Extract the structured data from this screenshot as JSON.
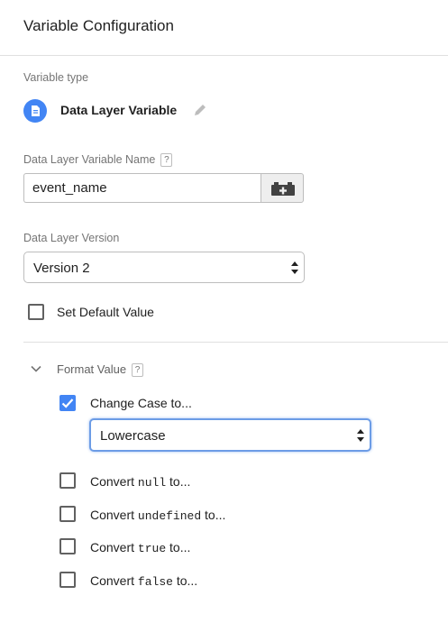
{
  "header": {
    "title": "Variable Configuration"
  },
  "variable_type": {
    "label": "Variable type",
    "name": "Data Layer Variable",
    "icon": "document-icon",
    "icon_color": "#4285f4"
  },
  "variable_name": {
    "label": "Data Layer Variable Name",
    "help": "?",
    "value": "event_name"
  },
  "version": {
    "label": "Data Layer Version",
    "selected": "Version 2"
  },
  "default_value": {
    "label": "Set Default Value",
    "checked": false
  },
  "format_value": {
    "title": "Format Value",
    "help": "?",
    "expanded": true,
    "change_case": {
      "label": "Change Case to...",
      "checked": true,
      "selected": "Lowercase"
    },
    "converts": [
      {
        "prefix": "Convert ",
        "code": "null",
        "suffix": " to...",
        "checked": false
      },
      {
        "prefix": "Convert ",
        "code": "undefined",
        "suffix": " to...",
        "checked": false
      },
      {
        "prefix": "Convert ",
        "code": "true",
        "suffix": " to...",
        "checked": false
      },
      {
        "prefix": "Convert ",
        "code": "false",
        "suffix": " to...",
        "checked": false
      }
    ]
  },
  "colors": {
    "accent": "#4285f4",
    "focus_outline": "#6c9ce6",
    "muted_text": "#757575"
  }
}
